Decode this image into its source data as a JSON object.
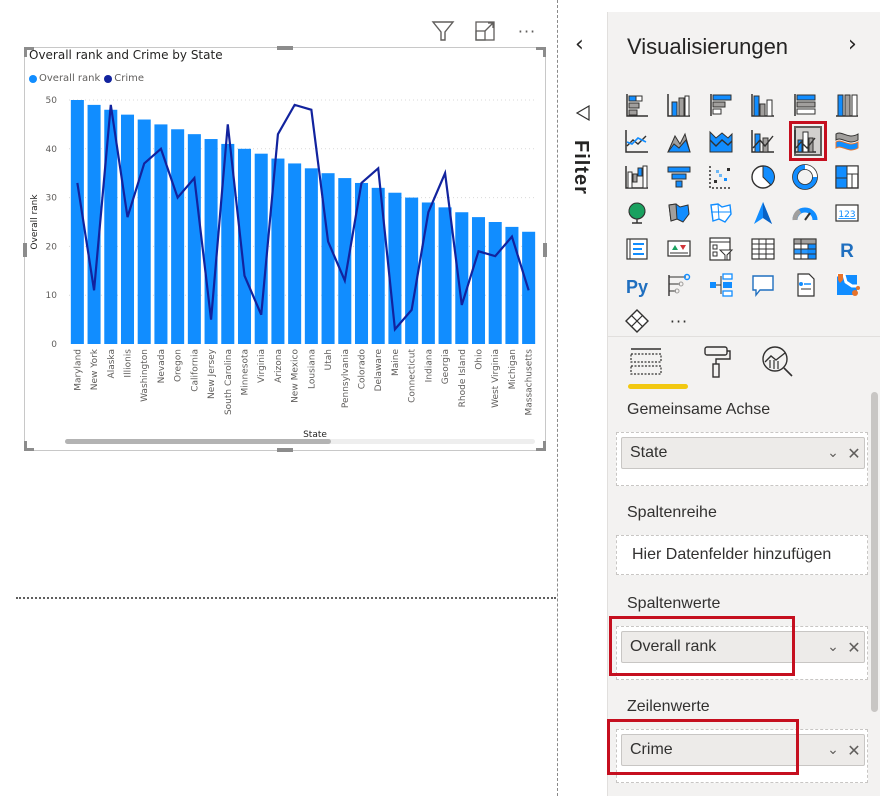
{
  "visual_header": {
    "filter_icon": "filter-icon",
    "focus_icon": "focus-mode-icon",
    "more_icon": "more-options-icon",
    "more_label": "···"
  },
  "filter_pane": {
    "collapse_glyph": "‹",
    "label": "Filter"
  },
  "viz_pane": {
    "title": "Visualisierungen",
    "expand_glyph": "›",
    "more_label": "···",
    "icons": [
      "stacked-bar-chart-icon",
      "stacked-column-chart-icon",
      "clustered-bar-chart-icon",
      "clustered-column-chart-icon",
      "100-stacked-bar-chart-icon",
      "100-stacked-column-chart-icon",
      "line-chart-icon",
      "area-chart-icon",
      "stacked-area-chart-icon",
      "line-stacked-column-chart-icon",
      "line-clustered-column-chart-icon",
      "ribbon-chart-icon",
      "waterfall-chart-icon",
      "funnel-chart-icon",
      "scatter-chart-icon",
      "pie-chart-icon",
      "donut-chart-icon",
      "treemap-icon",
      "map-icon",
      "filled-map-icon",
      "shape-map-icon",
      "azure-map-icon",
      "gauge-icon",
      "card-icon",
      "multi-row-card-icon",
      "kpi-icon",
      "slicer-icon",
      "table-icon",
      "matrix-icon",
      "r-visual-icon",
      "python-visual-icon",
      "key-influencers-icon",
      "decomposition-tree-icon",
      "qa-icon",
      "paginated-report-icon",
      "arcgis-map-icon",
      "power-apps-icon",
      "more-visuals-icon"
    ],
    "selected_icon": "line-clustered-column-chart-icon",
    "r_label": "R",
    "py_label": "Py",
    "card_label": "123",
    "tabs": [
      "fields-tab",
      "format-tab",
      "analytics-tab"
    ],
    "active_tab": "fields-tab",
    "wells": {
      "shared_axis": {
        "label": "Gemeinsame Achse",
        "field": "State"
      },
      "column_series": {
        "label": "Spaltenreihe",
        "placeholder": "Hier Datenfelder hinzufügen"
      },
      "column_values": {
        "label": "Spaltenwerte",
        "field": "Overall rank"
      },
      "line_values": {
        "label": "Zeilenwerte",
        "field": "Crime"
      }
    }
  },
  "colors": {
    "bar": "#118dff",
    "line": "#12239e",
    "highlight": "#c50f1f",
    "tab_underline": "#f2c811"
  },
  "chart_data": {
    "type": "bar+line",
    "title": "Overall rank and Crime by State",
    "xlabel": "State",
    "ylabel": "Overall rank",
    "ylim": [
      0,
      50
    ],
    "yticks": [
      0,
      10,
      20,
      30,
      40,
      50
    ],
    "grid": true,
    "legend_position": "top-left",
    "categories": [
      "Maryland",
      "New York",
      "Alaska",
      "Illionis",
      "Washington",
      "Nevada",
      "Oregon",
      "California",
      "New Jersey",
      "South Carolina",
      "Minnesota",
      "Virginia",
      "Arizona",
      "New Mexico",
      "Lousiana",
      "Utah",
      "Pennsylvania",
      "Colorado",
      "Delaware",
      "Maine",
      "Connecticut",
      "Indiana",
      "Georgia",
      "Rhode Island",
      "Ohio",
      "West Virginia",
      "Michigan",
      "Massachusetts"
    ],
    "series": [
      {
        "name": "Overall rank",
        "kind": "bar",
        "values": [
          50,
          49,
          48,
          47,
          46,
          45,
          44,
          43,
          42,
          41,
          40,
          39,
          38,
          37,
          36,
          35,
          34,
          33,
          32,
          31,
          30,
          29,
          28,
          27,
          26,
          25,
          24,
          23
        ]
      },
      {
        "name": "Crime",
        "kind": "line",
        "values": [
          33,
          11,
          49,
          26,
          37,
          40,
          30,
          34,
          5,
          45,
          14,
          6,
          43,
          49,
          48,
          21,
          13,
          33,
          36,
          3,
          7,
          27,
          35,
          8,
          19,
          18,
          22,
          11
        ]
      }
    ]
  }
}
